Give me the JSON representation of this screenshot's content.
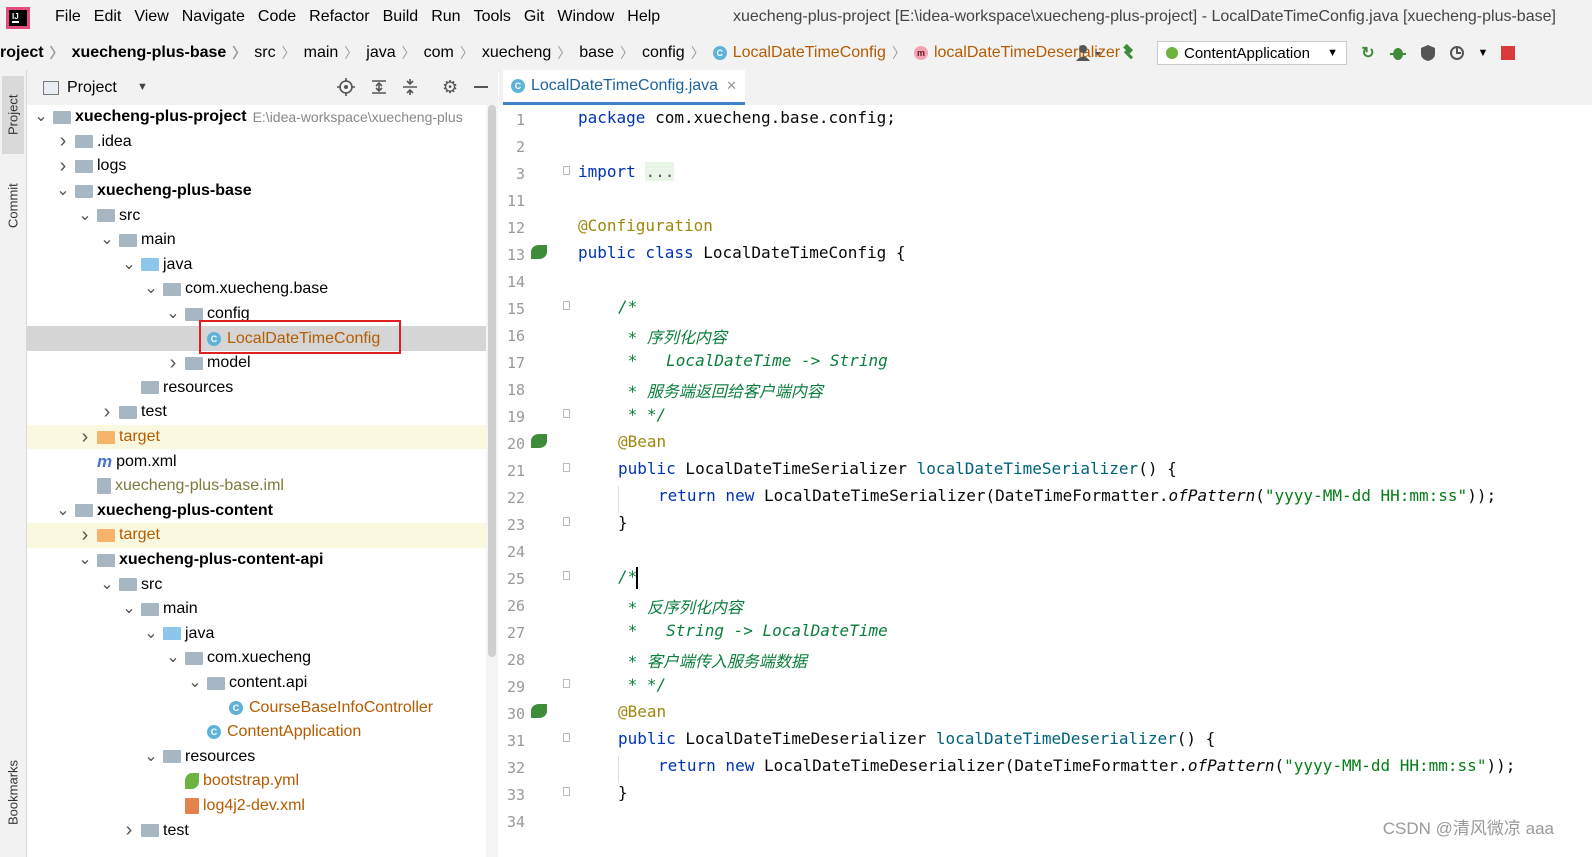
{
  "menu": {
    "items": [
      "File",
      "Edit",
      "View",
      "Navigate",
      "Code",
      "Refactor",
      "Build",
      "Run",
      "Tools",
      "Git",
      "Window",
      "Help"
    ],
    "window_title": "xuecheng-plus-project [E:\\idea-workspace\\xuecheng-plus-project] - LocalDateTimeConfig.java [xuecheng-plus-base]"
  },
  "breadcrumb": [
    "roject",
    "xuecheng-plus-base",
    "src",
    "main",
    "java",
    "com",
    "xuecheng",
    "base",
    "config",
    "LocalDateTimeConfig",
    "localDateTimeDeserializer"
  ],
  "toolbar": {
    "run_config": "ContentApplication"
  },
  "leftstrip": {
    "project": "Project",
    "commit": "Commit",
    "bookmarks": "Bookmarks"
  },
  "project_panel": {
    "title": "Project",
    "tree": [
      {
        "label": "xuecheng-plus-project",
        "extra": "E:\\idea-workspace\\xuecheng-plus",
        "depth": 0,
        "arrow": "down",
        "icon": "module",
        "bold": true
      },
      {
        "label": ".idea",
        "depth": 1,
        "arrow": "right",
        "icon": "folder"
      },
      {
        "label": "logs",
        "depth": 1,
        "arrow": "right",
        "icon": "folder"
      },
      {
        "label": "xuecheng-plus-base",
        "depth": 1,
        "arrow": "down",
        "icon": "module",
        "bold": true
      },
      {
        "label": "src",
        "depth": 2,
        "arrow": "down",
        "icon": "folder"
      },
      {
        "label": "main",
        "depth": 3,
        "arrow": "down",
        "icon": "folder"
      },
      {
        "label": "java",
        "depth": 4,
        "arrow": "down",
        "icon": "folder-blue"
      },
      {
        "label": "com.xuecheng.base",
        "depth": 5,
        "arrow": "down",
        "icon": "package"
      },
      {
        "label": "config",
        "depth": 6,
        "arrow": "down",
        "icon": "package"
      },
      {
        "label": "LocalDateTimeConfig",
        "depth": 7,
        "arrow": "",
        "icon": "class",
        "color": "orange",
        "selected": true
      },
      {
        "label": "model",
        "depth": 6,
        "arrow": "right",
        "icon": "package"
      },
      {
        "label": "resources",
        "depth": 4,
        "arrow": "",
        "icon": "folder-res"
      },
      {
        "label": "test",
        "depth": 3,
        "arrow": "right",
        "icon": "folder"
      },
      {
        "label": "target",
        "depth": 2,
        "arrow": "right",
        "icon": "folder-orange",
        "color": "orange",
        "excluded": true
      },
      {
        "label": "pom.xml",
        "depth": 2,
        "arrow": "",
        "icon": "maven"
      },
      {
        "label": "xuecheng-plus-base.iml",
        "depth": 2,
        "arrow": "",
        "icon": "iml",
        "color": "olive"
      },
      {
        "label": "xuecheng-plus-content",
        "depth": 1,
        "arrow": "down",
        "icon": "module",
        "bold": true
      },
      {
        "label": "target",
        "depth": 2,
        "arrow": "right",
        "icon": "folder-orange",
        "color": "orange",
        "excluded": true
      },
      {
        "label": "xuecheng-plus-content-api",
        "depth": 2,
        "arrow": "down",
        "icon": "module",
        "bold": true
      },
      {
        "label": "src",
        "depth": 3,
        "arrow": "down",
        "icon": "folder"
      },
      {
        "label": "main",
        "depth": 4,
        "arrow": "down",
        "icon": "folder"
      },
      {
        "label": "java",
        "depth": 5,
        "arrow": "down",
        "icon": "folder-blue"
      },
      {
        "label": "com.xuecheng",
        "depth": 6,
        "arrow": "down",
        "icon": "package"
      },
      {
        "label": "content.api",
        "depth": 7,
        "arrow": "down",
        "icon": "package"
      },
      {
        "label": "CourseBaseInfoController",
        "depth": 8,
        "arrow": "",
        "icon": "class",
        "color": "orange"
      },
      {
        "label": "ContentApplication",
        "depth": 7,
        "arrow": "",
        "icon": "class-run",
        "color": "orange"
      },
      {
        "label": "resources",
        "depth": 5,
        "arrow": "down",
        "icon": "folder-res"
      },
      {
        "label": "bootstrap.yml",
        "depth": 6,
        "arrow": "",
        "icon": "yml",
        "color": "orange"
      },
      {
        "label": "log4j2-dev.xml",
        "depth": 6,
        "arrow": "",
        "icon": "xml",
        "color": "orange"
      },
      {
        "label": "test",
        "depth": 4,
        "arrow": "right",
        "icon": "folder"
      }
    ]
  },
  "editor": {
    "tab": "LocalDateTimeConfig.java",
    "line_numbers": [
      "1",
      "2",
      "3",
      "11",
      "12",
      "13",
      "14",
      "15",
      "16",
      "17",
      "18",
      "19",
      "20",
      "21",
      "22",
      "23",
      "24",
      "25",
      "26",
      "27",
      "28",
      "29",
      "30",
      "31",
      "32",
      "33",
      "34"
    ],
    "code": {
      "l1_kw": "package",
      "l1_rest": " com.xuecheng.base.config;",
      "l3_kw": "import",
      "l3_dots": "...",
      "l12": "@Configuration",
      "l13_kw": "public class",
      "l13_rest": " LocalDateTimeConfig {",
      "l15": "/*",
      "l16": " * 序列化内容",
      "l17": " *   LocalDateTime -> String",
      "l18": " * 服务端返回给客户端内容",
      "l19": " * */",
      "l20": "@Bean",
      "l21_kw": "public",
      "l21_type": " LocalDateTimeSerializer ",
      "l21_fn": "localDateTimeSerializer",
      "l21_rest": "() {",
      "l22_kw": "return new",
      "l22_a": " LocalDateTimeSerializer(DateTimeFormatter.",
      "l22_m": "ofPattern",
      "l22_b": "(",
      "l22_s": "\"yyyy-MM-dd HH:mm:ss\"",
      "l22_c": "));",
      "l23": "}",
      "l25": "/*",
      "l26": " * 反序列化内容",
      "l27": " *   String -> LocalDateTime",
      "l28": " * 客户端传入服务端数据",
      "l29": " * */",
      "l30": "@Bean",
      "l31_kw": "public",
      "l31_type": " LocalDateTimeDeserializer ",
      "l31_fn": "localDateTimeDeserializer",
      "l31_rest": "() {",
      "l32_kw": "return new",
      "l32_a": " LocalDateTimeDeserializer(DateTimeFormatter.",
      "l32_m": "ofPattern",
      "l32_b": "(",
      "l32_s": "\"yyyy-MM-dd HH:mm:ss\"",
      "l32_c": "));",
      "l33": "}"
    }
  },
  "watermark": "CSDN @清风微凉 aaa",
  "colors": {
    "accent": "#4083c9",
    "highlight_box": "#e02020",
    "keyword": "#0033b3",
    "string": "#067d17",
    "annotation": "#9e880d"
  }
}
